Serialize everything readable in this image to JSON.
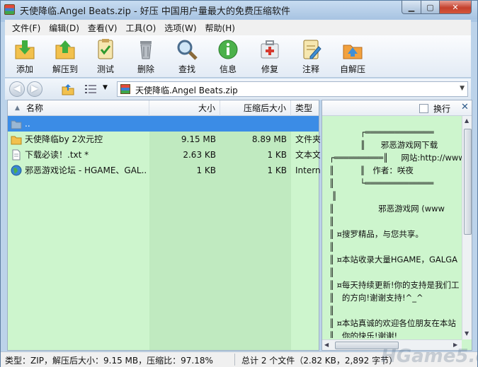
{
  "window": {
    "title": "天使降临.Angel Beats.zip - 好压 中国用户量最大的免费压缩软件"
  },
  "menu": [
    {
      "label": "文件(F)"
    },
    {
      "label": "编辑(D)"
    },
    {
      "label": "查看(V)"
    },
    {
      "label": "工具(O)"
    },
    {
      "label": "选项(W)"
    },
    {
      "label": "帮助(H)"
    }
  ],
  "toolbar": [
    {
      "label": "添加",
      "icon": "add-icon"
    },
    {
      "label": "解压到",
      "icon": "extract-to-icon"
    },
    {
      "label": "测试",
      "icon": "test-icon"
    },
    {
      "label": "删除",
      "icon": "delete-icon"
    },
    {
      "label": "查找",
      "icon": "find-icon"
    },
    {
      "label": "信息",
      "icon": "info-icon"
    },
    {
      "label": "修复",
      "icon": "repair-icon"
    },
    {
      "label": "注释",
      "icon": "comment-icon"
    },
    {
      "label": "自解压",
      "icon": "sfx-icon"
    }
  ],
  "address": {
    "path": "天使降临.Angel Beats.zip"
  },
  "columns": {
    "name": "名称",
    "size": "大小",
    "packed": "压缩后大小",
    "type": "类型"
  },
  "files": [
    {
      "name": "..",
      "size": "",
      "packed": "",
      "type": "",
      "icon": "up-folder-icon"
    },
    {
      "name": "天使降临by 2次元控",
      "size": "9.15 MB",
      "packed": "8.89 MB",
      "type": "文件夹",
      "icon": "folder-icon"
    },
    {
      "name": "下载必读！.txt *",
      "size": "2.63 KB",
      "packed": "1 KB",
      "type": "文本文",
      "icon": "text-file-icon"
    },
    {
      "name": "邪恶游戏论坛 - HGAME、GAL...",
      "size": "1 KB",
      "packed": "1 KB",
      "type": "Intern",
      "icon": "internet-shortcut-icon"
    }
  ],
  "preview": {
    "wrap_label": "换行",
    "lines": [
      "            ┌══════════════",
      "            ║      邪恶游戏网下载",
      "┌══════════║     网站:http://www",
      "║          ║   作者：咲夜",
      "║          └══════════════",
      " ║",
      "║                 邪恶游戏网 (www",
      "║",
      "║ ¤搜罗精品，与您共享。",
      "║",
      "║ ¤本站收录大量HGAME，GALGA",
      "║",
      "║ ¤每天持续更新!你的支持是我们工",
      "║   的方向!谢谢支持!^_^",
      "║",
      "║ ¤本站真诚的欢迎各位朋友在本站",
      "║   你的快乐!谢谢!"
    ]
  },
  "status": {
    "left": "类型：ZIP，解压后大小：9.15 MB，压缩比：97.18%",
    "right": "总计 2 个文件（2.82 KB，2,892 字节）"
  },
  "watermark": "HGame5.com",
  "colors": {
    "list_background": "#cdf5cd",
    "selection": "#3b8ce6",
    "title_gradient_top": "#c8dcf1"
  }
}
